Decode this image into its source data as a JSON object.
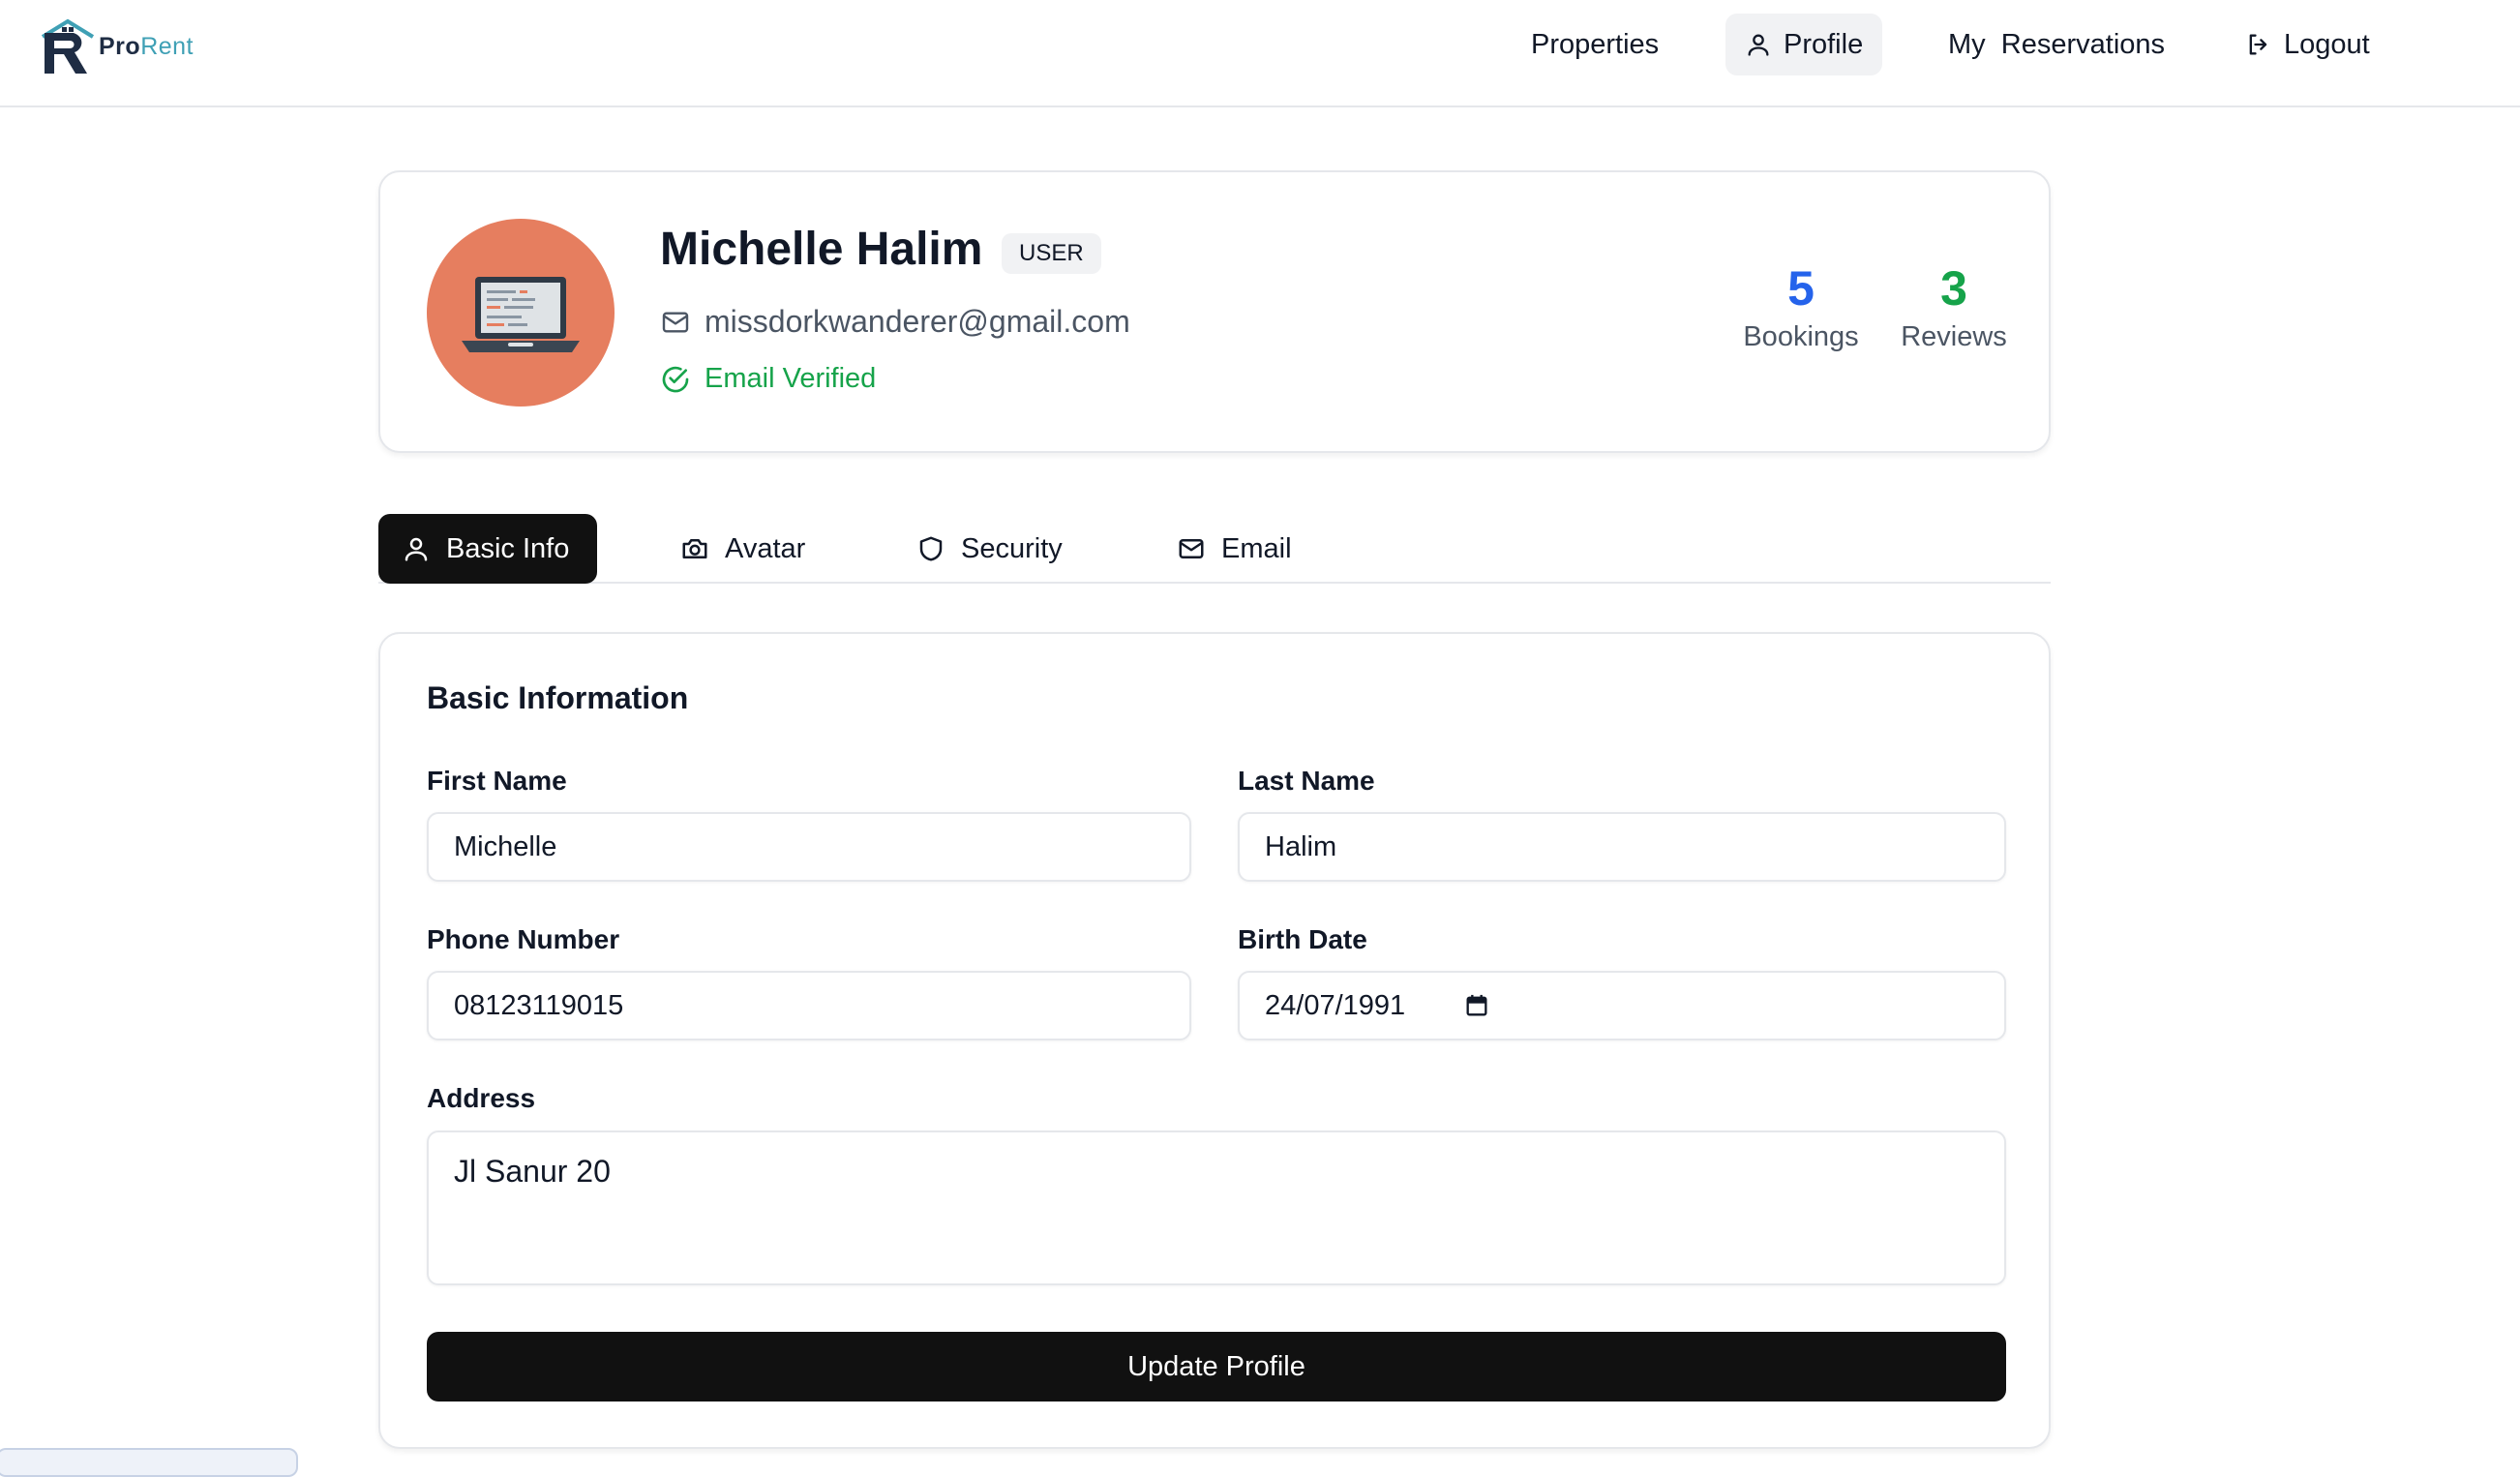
{
  "brand": {
    "logo_pro": "Pro",
    "logo_rent": "Rent",
    "colors": {
      "navy": "#1f2d44",
      "teal": "#3fa0b5"
    }
  },
  "nav": {
    "items": [
      {
        "label": "Properties",
        "icon": ""
      },
      {
        "label": "Profile",
        "icon": "user-icon",
        "active": true
      },
      {
        "label": "My  Reservations",
        "icon": ""
      },
      {
        "label": "Logout",
        "icon": "logout-icon"
      }
    ]
  },
  "profile": {
    "name": "Michelle Halim",
    "role": "USER",
    "email": "missdorkwanderer@gmail.com",
    "verified_label": "Email Verified",
    "avatar_bg": "#e67e5f",
    "stats": [
      {
        "value": "5",
        "label": "Bookings",
        "color": "#2563eb"
      },
      {
        "value": "3",
        "label": "Reviews",
        "color": "#16a34a"
      }
    ]
  },
  "tabs": [
    {
      "label": "Basic Info",
      "icon": "user-icon",
      "active": true
    },
    {
      "label": "Avatar",
      "icon": "camera-icon"
    },
    {
      "label": "Security",
      "icon": "shield-icon"
    },
    {
      "label": "Email",
      "icon": "mail-icon"
    }
  ],
  "form": {
    "title": "Basic Information",
    "first_name_label": "First Name",
    "first_name_value": "Michelle",
    "last_name_label": "Last Name",
    "last_name_value": "Halim",
    "phone_label": "Phone Number",
    "phone_value": "08123119015",
    "birth_label": "Birth Date",
    "birth_value": "24/07/1991",
    "address_label": "Address",
    "address_value": "Jl Sanur 20",
    "submit_label": "Update Profile"
  }
}
